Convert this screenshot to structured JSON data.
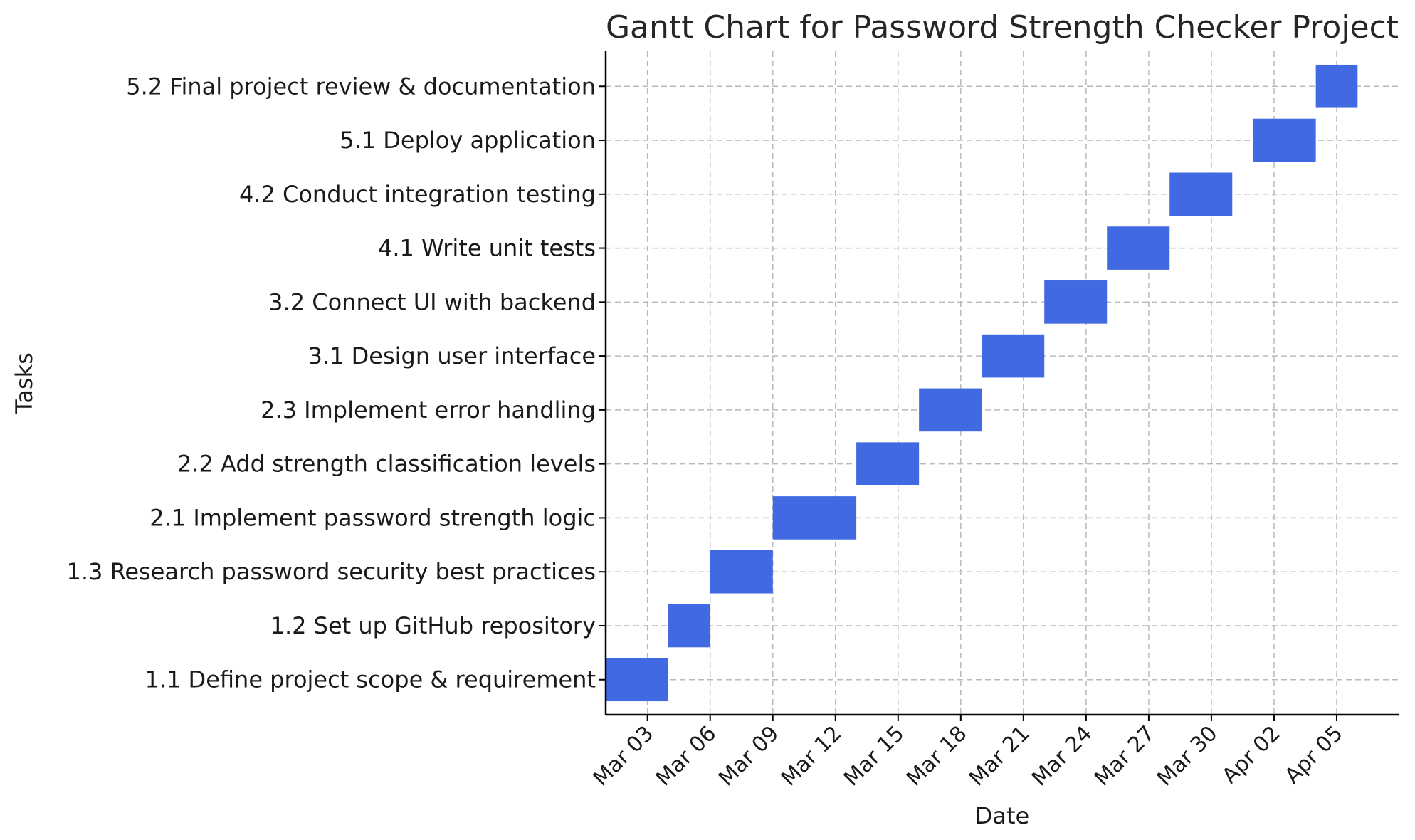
{
  "chart_data": {
    "type": "gantt",
    "title": "Gantt Chart for Password Strength Checker Project",
    "xlabel": "Date",
    "ylabel": "Tasks",
    "grid": true,
    "bar_color": "#4169e1",
    "x_ticks": [
      "Mar 03",
      "Mar 06",
      "Mar 09",
      "Mar 12",
      "Mar 15",
      "Mar 18",
      "Mar 21",
      "Mar 24",
      "Mar 27",
      "Mar 30",
      "Apr 02",
      "Apr 05"
    ],
    "xlim": [
      "2025-03-01",
      "2025-04-08"
    ],
    "tasks": [
      {
        "name": "1.1 Define project scope & requirement",
        "start": "2025-03-01",
        "end": "2025-03-03"
      },
      {
        "name": "1.2 Set up GitHub repository",
        "start": "2025-03-04",
        "end": "2025-03-05"
      },
      {
        "name": "1.3 Research password security best practices",
        "start": "2025-03-06",
        "end": "2025-03-08"
      },
      {
        "name": "2.1 Implement password strength logic",
        "start": "2025-03-09",
        "end": "2025-03-12"
      },
      {
        "name": "2.2 Add strength classification levels",
        "start": "2025-03-13",
        "end": "2025-03-15"
      },
      {
        "name": "2.3 Implement error handling",
        "start": "2025-03-16",
        "end": "2025-03-18"
      },
      {
        "name": "3.1 Design user interface",
        "start": "2025-03-19",
        "end": "2025-03-21"
      },
      {
        "name": "3.2 Connect UI with backend",
        "start": "2025-03-22",
        "end": "2025-03-24"
      },
      {
        "name": "4.1 Write unit tests",
        "start": "2025-03-25",
        "end": "2025-03-27"
      },
      {
        "name": "4.2 Conduct integration testing",
        "start": "2025-03-28",
        "end": "2025-03-30"
      },
      {
        "name": "5.1 Deploy application",
        "start": "2025-04-01",
        "end": "2025-04-03"
      },
      {
        "name": "5.2 Final project review & documentation",
        "start": "2025-04-04",
        "end": "2025-04-05"
      }
    ]
  }
}
